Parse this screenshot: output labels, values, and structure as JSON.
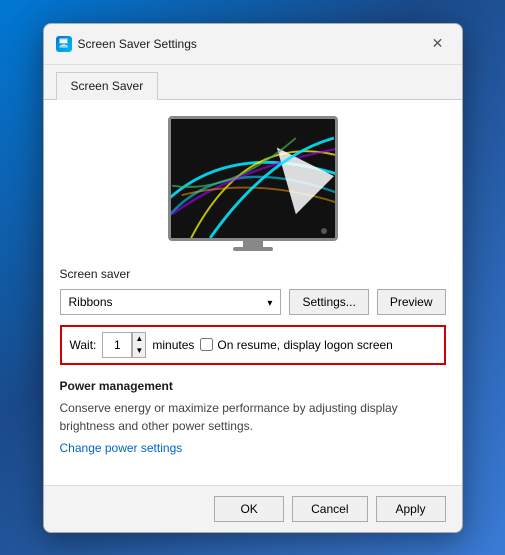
{
  "dialog": {
    "title": "Screen Saver Settings",
    "icon": "monitor-icon"
  },
  "tabs": [
    {
      "label": "Screen Saver",
      "active": true
    }
  ],
  "screensaver": {
    "section_label": "Screen saver",
    "selected": "Ribbons",
    "settings_button": "Settings...",
    "preview_button": "Preview",
    "wait_label": "Wait:",
    "wait_value": "1",
    "minutes_label": "minutes",
    "resume_label": "On resume, display logon screen",
    "resume_checked": false
  },
  "power": {
    "section_label": "Power management",
    "description": "Conserve energy or maximize performance by adjusting display brightness and other power settings.",
    "link_label": "Change power settings"
  },
  "footer": {
    "ok_label": "OK",
    "cancel_label": "Cancel",
    "apply_label": "Apply"
  },
  "colors": {
    "highlight_border": "#cc0000",
    "link": "#0066cc"
  }
}
